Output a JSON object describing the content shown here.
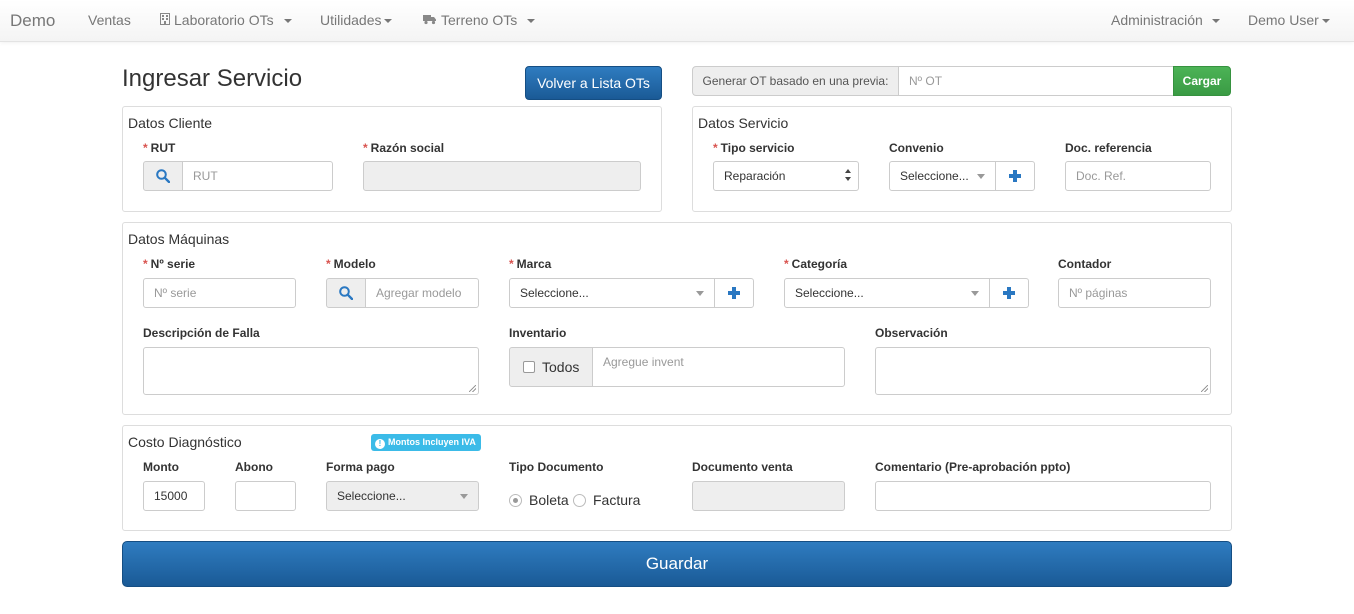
{
  "navbar": {
    "brand": "Demo",
    "items": [
      "Ventas",
      "Laboratorio OTs",
      "Utilidades",
      "Terreno OTs"
    ],
    "right_items": [
      "Administración",
      "Demo User"
    ]
  },
  "header": {
    "title": "Ingresar Servicio",
    "back_button": "Volver a Lista OTs",
    "previous_ot_label": "Generar OT basado en una previa:",
    "previous_ot_placeholder": "Nº OT",
    "load_button": "Cargar"
  },
  "cliente": {
    "title": "Datos Cliente",
    "rut_label": "RUT",
    "rut_placeholder": "RUT",
    "razon_label": "Razón social",
    "razon_value": ""
  },
  "servicio": {
    "title": "Datos Servicio",
    "tipo_label": "Tipo servicio",
    "tipo_value": "Reparación",
    "convenio_label": "Convenio",
    "convenio_value": "Seleccione...",
    "docref_label": "Doc. referencia",
    "docref_placeholder": "Doc. Ref."
  },
  "maquinas": {
    "title": "Datos Máquinas",
    "serie_label": "Nº serie",
    "serie_placeholder": "Nº serie",
    "modelo_label": "Modelo",
    "modelo_placeholder": "Agregar modelo",
    "marca_label": "Marca",
    "marca_value": "Seleccione...",
    "categoria_label": "Categoría",
    "categoria_value": "Seleccione...",
    "contador_label": "Contador",
    "contador_placeholder": "Nº páginas",
    "falla_label": "Descripción de Falla",
    "inventario_label": "Inventario",
    "todos_label": "Todos",
    "inventario_placeholder": "Agregue invent",
    "observacion_label": "Observación"
  },
  "costo": {
    "title": "Costo Diagnóstico",
    "iva_badge": "Montos Incluyen IVA",
    "monto_label": "Monto",
    "monto_value": "15000",
    "abono_label": "Abono",
    "abono_value": "",
    "forma_label": "Forma pago",
    "forma_value": "Seleccione...",
    "tipo_doc_label": "Tipo Documento",
    "boleta_label": "Boleta",
    "factura_label": "Factura",
    "selected_doc": "Boleta",
    "doc_venta_label": "Documento venta",
    "comentario_label": "Comentario (Pre-aprobación ppto)"
  },
  "save_button": "Guardar",
  "colors": {
    "primary": "#1f63a6",
    "success": "#42a84c",
    "info_badge": "#3bbbe8",
    "required": "#d9534f"
  }
}
